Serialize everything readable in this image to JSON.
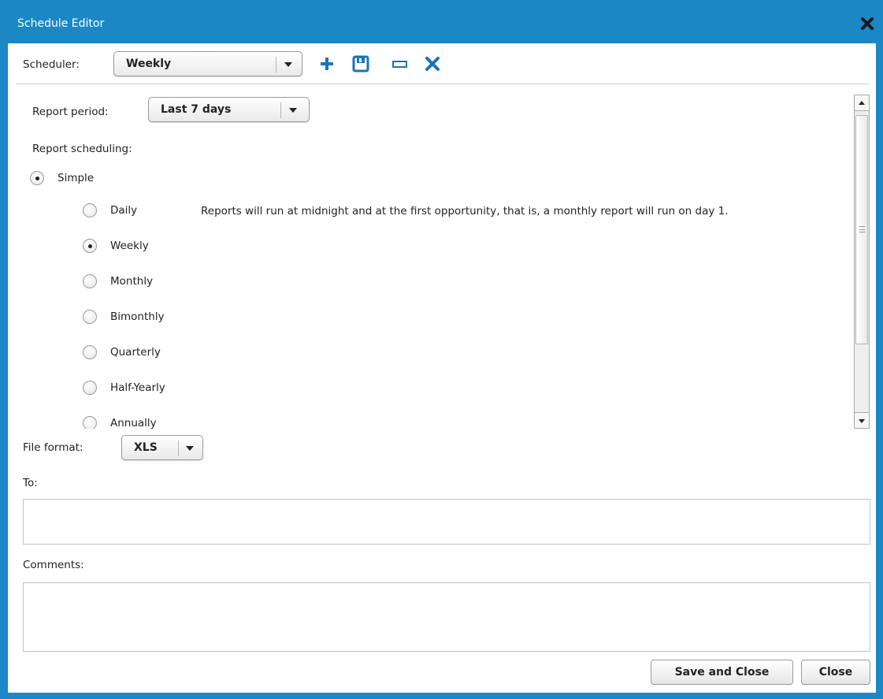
{
  "window": {
    "title": "Schedule Editor"
  },
  "toolbar": {
    "scheduler_label": "Scheduler:",
    "scheduler_value": "Weekly"
  },
  "report": {
    "period_label": "Report period:",
    "period_value": "Last 7 days",
    "scheduling_label": "Report scheduling:",
    "mode": {
      "label": "Simple",
      "checked": true
    },
    "frequency_options": [
      {
        "label": "Daily",
        "checked": false
      },
      {
        "label": "Weekly",
        "checked": true
      },
      {
        "label": "Monthly",
        "checked": false
      },
      {
        "label": "Bimonthly",
        "checked": false
      },
      {
        "label": "Quarterly",
        "checked": false
      },
      {
        "label": "Half-Yearly",
        "checked": false
      },
      {
        "label": "Annually",
        "checked": false
      }
    ],
    "info_text": "Reports will run at midnight and at the first opportunity, that is, a monthly report will run on day 1."
  },
  "file_format": {
    "label": "File format:",
    "value": "XLS"
  },
  "to": {
    "label": "To:",
    "value": ""
  },
  "comments": {
    "label": "Comments:",
    "value": ""
  },
  "buttons": {
    "save_close": "Save and Close",
    "close": "Close"
  },
  "colors": {
    "frame": "#1b87c4",
    "toolbar_icon": "#1a74b7"
  },
  "icons": [
    "close-icon",
    "add-icon",
    "save-icon",
    "rename-icon",
    "delete-icon",
    "dropdown-arrow-icon"
  ]
}
